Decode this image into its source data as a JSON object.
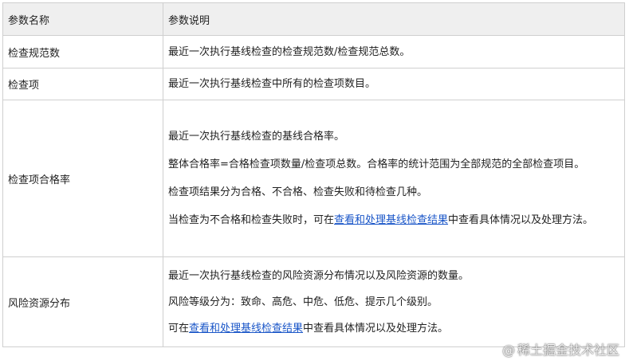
{
  "table": {
    "headers": [
      "参数名称",
      "参数说明"
    ],
    "rows": [
      {
        "name": "检查规范数",
        "paragraphs": [
          "最近一次执行基线检查的检查规范数/检查规范总数。"
        ]
      },
      {
        "name": "检查项",
        "paragraphs": [
          "最近一次执行基线检查中所有的检查项数目。"
        ]
      },
      {
        "name": "检查项合格率",
        "paragraphs": [
          "最近一次执行基线检查的基线合格率。",
          "整体合格率=合格检查项数量/检查项总数。合格率的统计范围为全部规范的全部检查项目。",
          "检查项结果分为合格、不合格、检查失败和待检查几种。"
        ],
        "link_paragraph": {
          "before": "当检查为不合格和检查失败时，可在",
          "link": "查看和处理基线检查结果",
          "after": "中查看具体情况以及处理方法。"
        }
      },
      {
        "name": "风险资源分布",
        "paragraphs": [
          "最近一次执行基线检查的风险资源分布情况以及风险资源的数量。",
          "风险等级分为：致命、高危、中危、低危、提示几个级别。"
        ],
        "link_paragraph": {
          "before": "可在",
          "link": "查看和处理基线检查结果",
          "after": "中查看具体情况以及处理方法。"
        }
      }
    ]
  },
  "watermark": {
    "text": "稀土掘金技术社区",
    "icon": "weibo-at-icon"
  },
  "colors": {
    "link": "#1a56c8",
    "header_bg": "#efefef",
    "border": "#cfcfcf"
  }
}
